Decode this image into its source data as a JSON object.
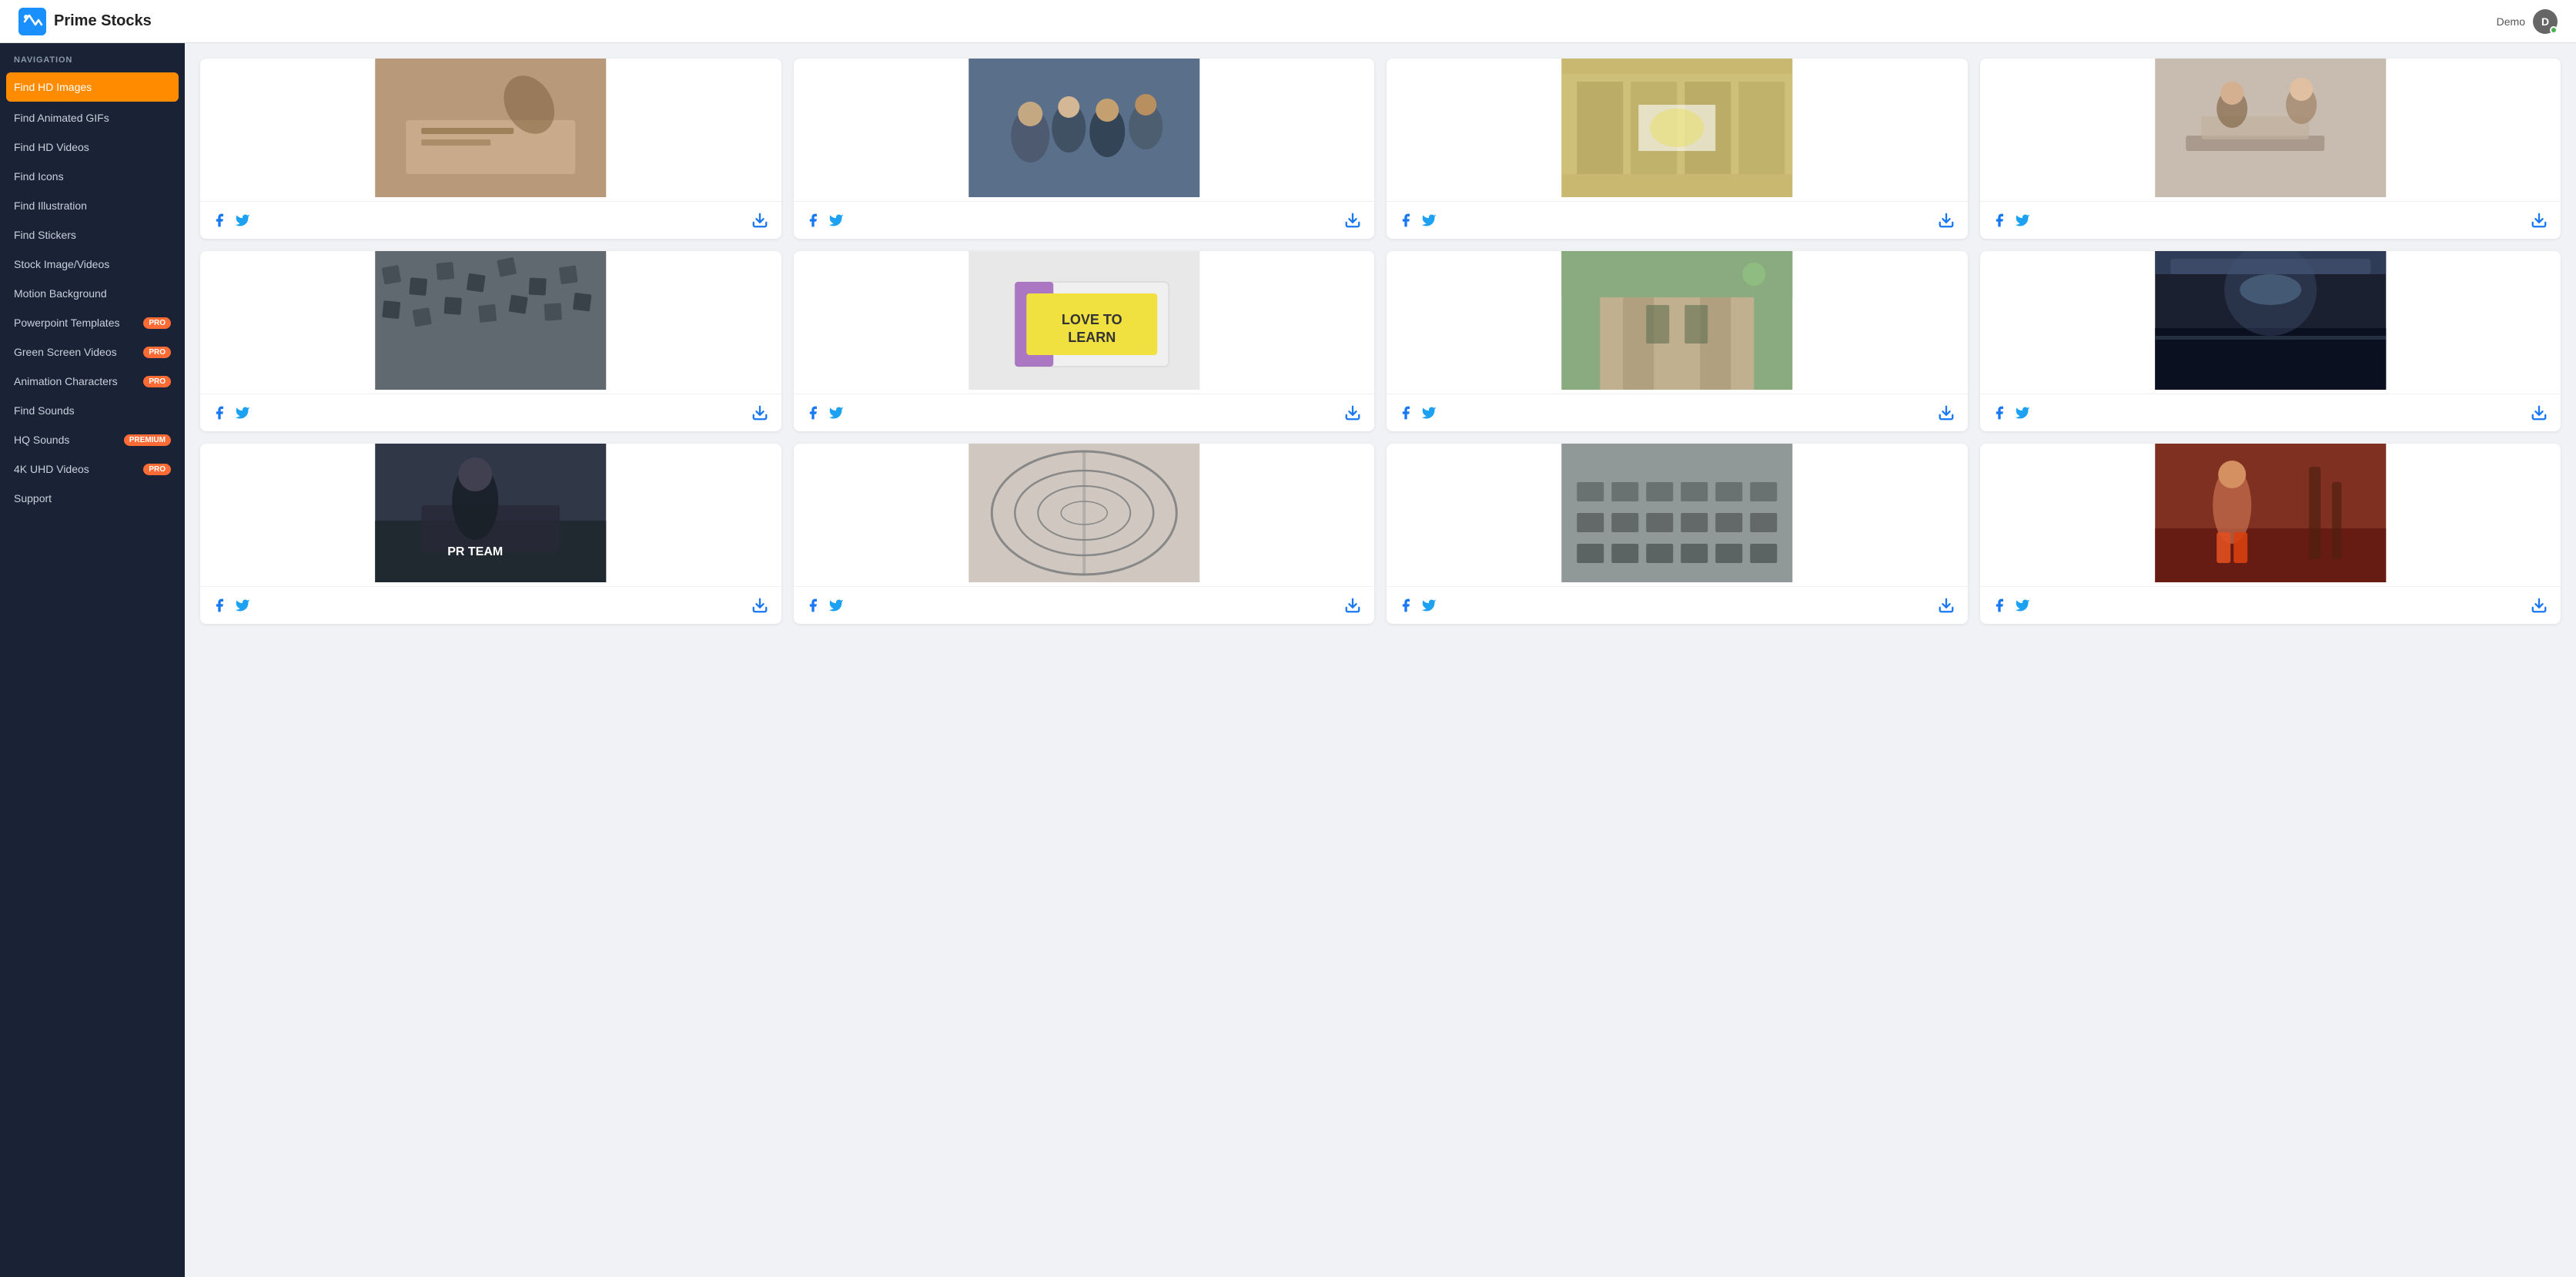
{
  "header": {
    "app_name": "Prime Stocks",
    "user_label": "Demo",
    "nav_section_label": "NAVIGATION"
  },
  "sidebar": {
    "items": [
      {
        "id": "find-hd-images",
        "label": "Find HD Images",
        "active": true,
        "badge": null
      },
      {
        "id": "find-animated-gifs",
        "label": "Find Animated GIFs",
        "active": false,
        "badge": null
      },
      {
        "id": "find-hd-videos",
        "label": "Find HD Videos",
        "active": false,
        "badge": null
      },
      {
        "id": "find-icons",
        "label": "Find Icons",
        "active": false,
        "badge": null
      },
      {
        "id": "find-illustration",
        "label": "Find Illustration",
        "active": false,
        "badge": null
      },
      {
        "id": "find-stickers",
        "label": "Find Stickers",
        "active": false,
        "badge": null
      },
      {
        "id": "stock-image-videos",
        "label": "Stock Image/Videos",
        "active": false,
        "badge": null
      },
      {
        "id": "motion-background",
        "label": "Motion Background",
        "active": false,
        "badge": null
      },
      {
        "id": "powerpoint-templates",
        "label": "Powerpoint Templates",
        "active": false,
        "badge": "Pro"
      },
      {
        "id": "green-screen-videos",
        "label": "Green Screen Videos",
        "active": false,
        "badge": "Pro"
      },
      {
        "id": "animation-characters",
        "label": "Animation Characters",
        "active": false,
        "badge": "Pro"
      },
      {
        "id": "find-sounds",
        "label": "Find Sounds",
        "active": false,
        "badge": null
      },
      {
        "id": "hq-sounds",
        "label": "HQ Sounds",
        "active": false,
        "badge": "Premium"
      },
      {
        "id": "4k-uhd-videos",
        "label": "4K UHD Videos",
        "active": false,
        "badge": "Pro"
      },
      {
        "id": "support",
        "label": "Support",
        "active": false,
        "badge": null
      }
    ]
  },
  "grid": {
    "cards": [
      {
        "id": 1,
        "colorClass": "color1",
        "alt": "Person writing on paper"
      },
      {
        "id": 2,
        "colorClass": "color2",
        "alt": "Students in classroom"
      },
      {
        "id": 3,
        "colorClass": "color3",
        "alt": "Classroom with projector"
      },
      {
        "id": 4,
        "colorClass": "color4",
        "alt": "Women working with laptop"
      },
      {
        "id": 5,
        "colorClass": "color5",
        "alt": "Graduation caps aerial view"
      },
      {
        "id": 6,
        "colorClass": "color6",
        "alt": "Love to Learn sign"
      },
      {
        "id": 7,
        "colorClass": "color7",
        "alt": "Gothic university building"
      },
      {
        "id": 8,
        "colorClass": "color8",
        "alt": "Auditorium with lights"
      },
      {
        "id": 9,
        "colorClass": "color9",
        "alt": "PR Team person at desk"
      },
      {
        "id": 10,
        "colorClass": "color10",
        "alt": "Abstract circular library"
      },
      {
        "id": 11,
        "colorClass": "color11",
        "alt": "Empty chairs rows"
      },
      {
        "id": 12,
        "colorClass": "color12",
        "alt": "Woman exercising in gym"
      }
    ]
  },
  "icons": {
    "facebook": "f",
    "twitter": "t",
    "download": "⬇"
  }
}
